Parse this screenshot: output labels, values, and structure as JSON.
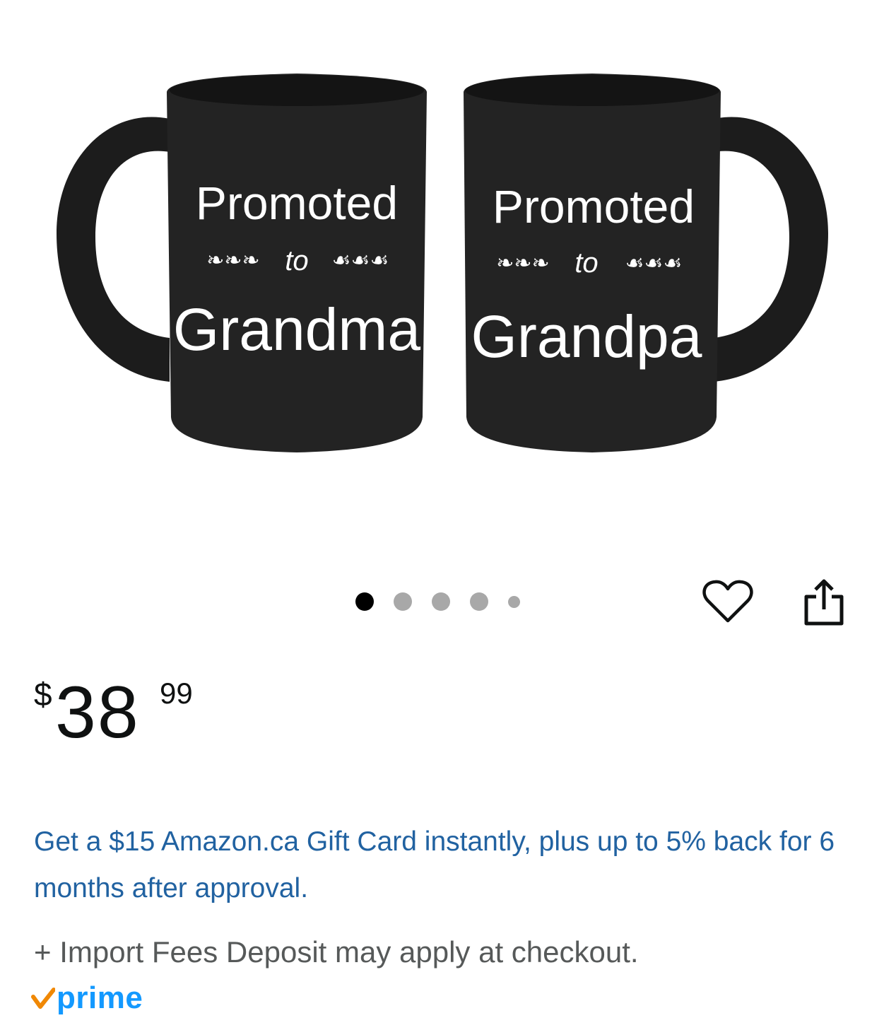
{
  "product_image": {
    "mug_left": {
      "line1": "Promoted",
      "line2": "to",
      "line3": "Grandma"
    },
    "mug_right": {
      "line1": "Promoted",
      "line2": "to",
      "line3": "Grandpa"
    }
  },
  "carousel": {
    "total": 5,
    "active_index": 0
  },
  "actions": {
    "wishlist_icon": "heart-icon",
    "share_icon": "share-icon"
  },
  "price": {
    "symbol": "$",
    "whole": "38",
    "fraction": "99"
  },
  "promo_text": "Get a $15 Amazon.ca Gift Card instantly, plus up to 5% back for 6 months after approval.",
  "import_note": "+ Import Fees Deposit may apply at checkout.",
  "prime": {
    "label": "prime",
    "check_color": "#f08804",
    "label_color": "#1399ff"
  },
  "colors": {
    "link": "#2162a1",
    "muted": "#565959",
    "dot_active": "#000000",
    "dot_inactive": "#a8a8a8"
  }
}
